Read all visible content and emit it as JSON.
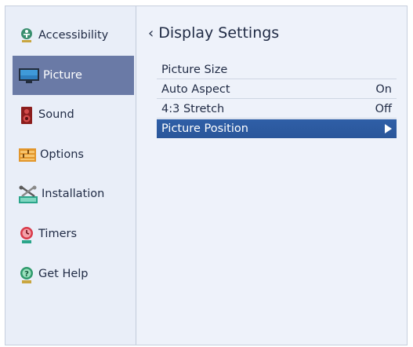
{
  "sidebar": {
    "items": [
      {
        "label": "Accessibility",
        "icon": "accessibility-icon"
      },
      {
        "label": "Picture",
        "icon": "tv-picture-icon",
        "selected": true
      },
      {
        "label": "Sound",
        "icon": "speaker-icon"
      },
      {
        "label": "Options",
        "icon": "options-icon"
      },
      {
        "label": "Installation",
        "icon": "installation-tools-icon"
      },
      {
        "label": "Timers",
        "icon": "timer-icon"
      },
      {
        "label": "Get Help",
        "icon": "help-icon"
      }
    ]
  },
  "main": {
    "title": "Display Settings",
    "back_icon": "chevron-left-icon",
    "rows": [
      {
        "label": "Picture Size",
        "value": ""
      },
      {
        "label": "Auto Aspect",
        "value": "On"
      },
      {
        "label": "4:3 Stretch",
        "value": "Off"
      },
      {
        "label": "Picture Position",
        "value": "",
        "selected": true,
        "icon": "play-arrow-icon"
      }
    ]
  },
  "colors": {
    "sidebar_selected": "#6a7aa6",
    "row_selected": "#2f5fa7",
    "background": "#eef2fa"
  }
}
